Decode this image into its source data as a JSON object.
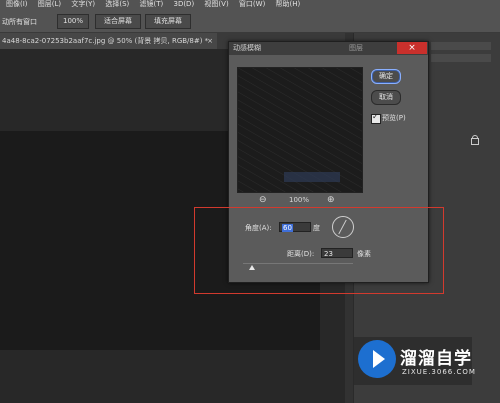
{
  "menubar": {
    "items": [
      "图像(I)",
      "图层(L)",
      "文字(Y)",
      "选择(S)",
      "滤镜(T)",
      "3D(D)",
      "视图(V)",
      "窗口(W)",
      "帮助(H)"
    ]
  },
  "options": {
    "fit_all_windows": "动所有窗口",
    "zoom_100": "100%",
    "fit_screen": "适合屏幕",
    "fill_screen": "填充屏幕"
  },
  "document": {
    "tab_title": "4a48-8ca2-07253b2aaf7c.jpg @ 50% (背景 拷贝, RGB/8#) *",
    "tab_close": "×"
  },
  "dialog": {
    "title": "动感模糊",
    "behind_title": "图层",
    "close": "×",
    "ok_label": "确定",
    "cancel_label": "取消",
    "preview_label": "预览(P)",
    "zoom_out": "⊖",
    "zoom_value": "100%",
    "zoom_in": "⊕",
    "angle_label": "角度(A):",
    "angle_value": "60",
    "angle_unit": "度",
    "distance_label": "距离(D):",
    "distance_value": "23",
    "distance_unit": "像素",
    "distance_slider_fraction": 0.08
  },
  "right_panel": {
    "icons": [
      "lock-icon"
    ]
  },
  "watermark": {
    "title": "溜溜自学",
    "subtitle": "ZIXUE.3066.COM"
  },
  "colors": {
    "highlight_box": "#d23a2e",
    "selection": "#3f6fd8",
    "watermark_blue": "#1d6fd0",
    "close_button": "#c9302c"
  }
}
